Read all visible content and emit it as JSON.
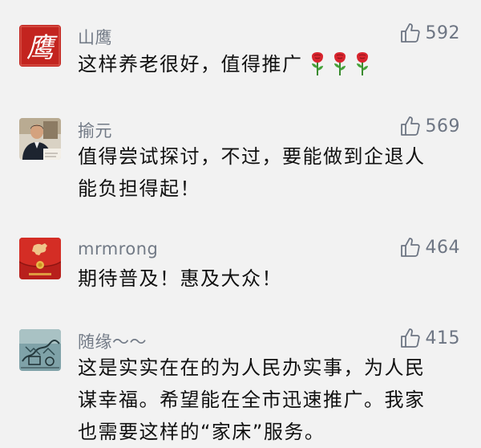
{
  "comments": [
    {
      "username": "山鹰",
      "avatar": "eagle-calligraphy-avatar",
      "avatar_text": "鹰",
      "likes": "592",
      "lines": [
        "这样养老很好，值得推广"
      ],
      "emoji": [
        "rose-emoji",
        "rose-emoji",
        "rose-emoji"
      ]
    },
    {
      "username": "揄元",
      "avatar": "man-portrait-avatar",
      "likes": "569",
      "lines": [
        "值得尝试探讨，不过，要能做到企退人",
        "能负担得起！"
      ]
    },
    {
      "username": "mrmrong",
      "avatar": "red-envelope-avatar",
      "likes": "464",
      "lines": [
        "期待普及！惠及大众！"
      ]
    },
    {
      "username": "随缘～～",
      "avatar": "sketch-drawing-avatar",
      "likes": "415",
      "lines": [
        "这是实实在在的为人民办实事，为人民",
        "谋幸福。希望能在全市迅速推广。我家",
        "也需要这样的“家床”服务。"
      ]
    }
  ],
  "colors": {
    "background": "#f2f2f2",
    "username": "#727a86",
    "like": "#6d7583",
    "content": "#111111",
    "rose_red": "#d8252e",
    "avatar_red": "#c3241f"
  }
}
